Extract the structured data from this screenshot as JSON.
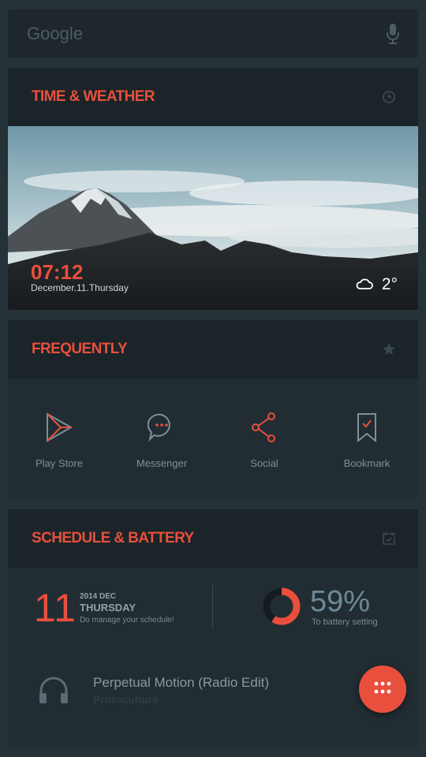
{
  "search": {
    "placeholder": "Google"
  },
  "weather_card": {
    "title": "TIME & WEATHER",
    "time": "07:12",
    "date": "December.11.Thursday",
    "temperature": "2°"
  },
  "frequent_card": {
    "title": "FREQUENTLY",
    "apps": [
      {
        "label": "Play Store",
        "icon": "play-store-icon"
      },
      {
        "label": "Messenger",
        "icon": "messenger-icon"
      },
      {
        "label": "Social",
        "icon": "share-icon"
      },
      {
        "label": "Bookmark",
        "icon": "bookmark-icon"
      }
    ]
  },
  "schedule_card": {
    "title": "SCHEDULE & BATTERY",
    "day_number": "11",
    "year_month": "2014 DEC",
    "weekday": "THURSDAY",
    "hint": "Do manage your schedule!",
    "battery_percent_label": "59%",
    "battery_percent": 0.59,
    "battery_hint": "To battery setting",
    "song_title": "Perpetual Motion (Radio Edit)",
    "song_artist": "Protoculture"
  },
  "colors": {
    "accent": "#e84f3d",
    "background": "#253238",
    "card": "#212d33",
    "card_header": "#1b2428"
  }
}
